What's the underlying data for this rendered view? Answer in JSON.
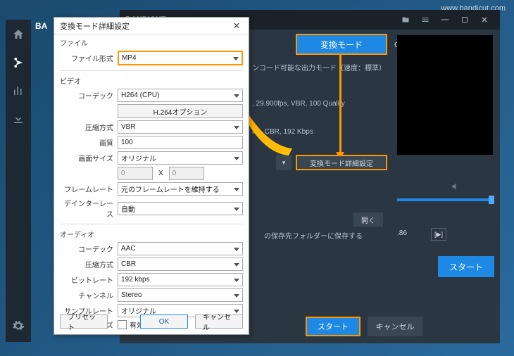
{
  "watermark": "www.bandicut.com",
  "app_name": "BANDICUT",
  "sidebar": {
    "items": [
      "home",
      "scissors",
      "equalizer",
      "download",
      "settings"
    ]
  },
  "mode_button": "変換モード",
  "info_lines": {
    "encode": "ンコード可能な出力モード（速度：標準）",
    "video": ", 29.900fps, VBR, 100 Quality",
    "audio": "Hz, CBR, 192 Kbps",
    "save": "の保存先フォルダーに保存する"
  },
  "detail_button": "変換モード詳細設定",
  "open_button": "開く",
  "bottom": {
    "start": "スタート",
    "cancel": "キャンセル"
  },
  "preview": {
    "timecode": ".86",
    "ob": "OB",
    "big_start": "スタート"
  },
  "dialog": {
    "title": "変換モード詳細設定",
    "groups": {
      "file": "ファイル",
      "video": "ビデオ",
      "audio": "オーディオ"
    },
    "file": {
      "format_label": "ファイル形式",
      "format": "MP4"
    },
    "video": {
      "codec_label": "コーデック",
      "codec": "H264 (CPU)",
      "h264_options": "H.264オプション",
      "compression_label": "圧縮方式",
      "compression": "VBR",
      "quality_label": "画質",
      "quality": "100",
      "size_label": "画面サイズ",
      "size": "オリジナル",
      "w": "0",
      "h": "0",
      "framerate_label": "フレームレート",
      "framerate": "元のフレームレートを維持する",
      "deinterlace_label": "デインターレース",
      "deinterlace": "自動"
    },
    "audio": {
      "codec_label": "コーデック",
      "codec": "AAC",
      "compression_label": "圧縮方式",
      "compression": "CBR",
      "bitrate_label": "ビットレート",
      "bitrate": "192 kbps",
      "channel_label": "チャンネル",
      "channel": "Stereo",
      "samplerate_label": "サンプルレート",
      "samplerate": "オリジナル",
      "normalize_label": "ノーマライズ",
      "normalize_check": "有効"
    },
    "buttons": {
      "preset": "プリセット",
      "ok": "OK",
      "cancel": "キャンセル"
    }
  }
}
